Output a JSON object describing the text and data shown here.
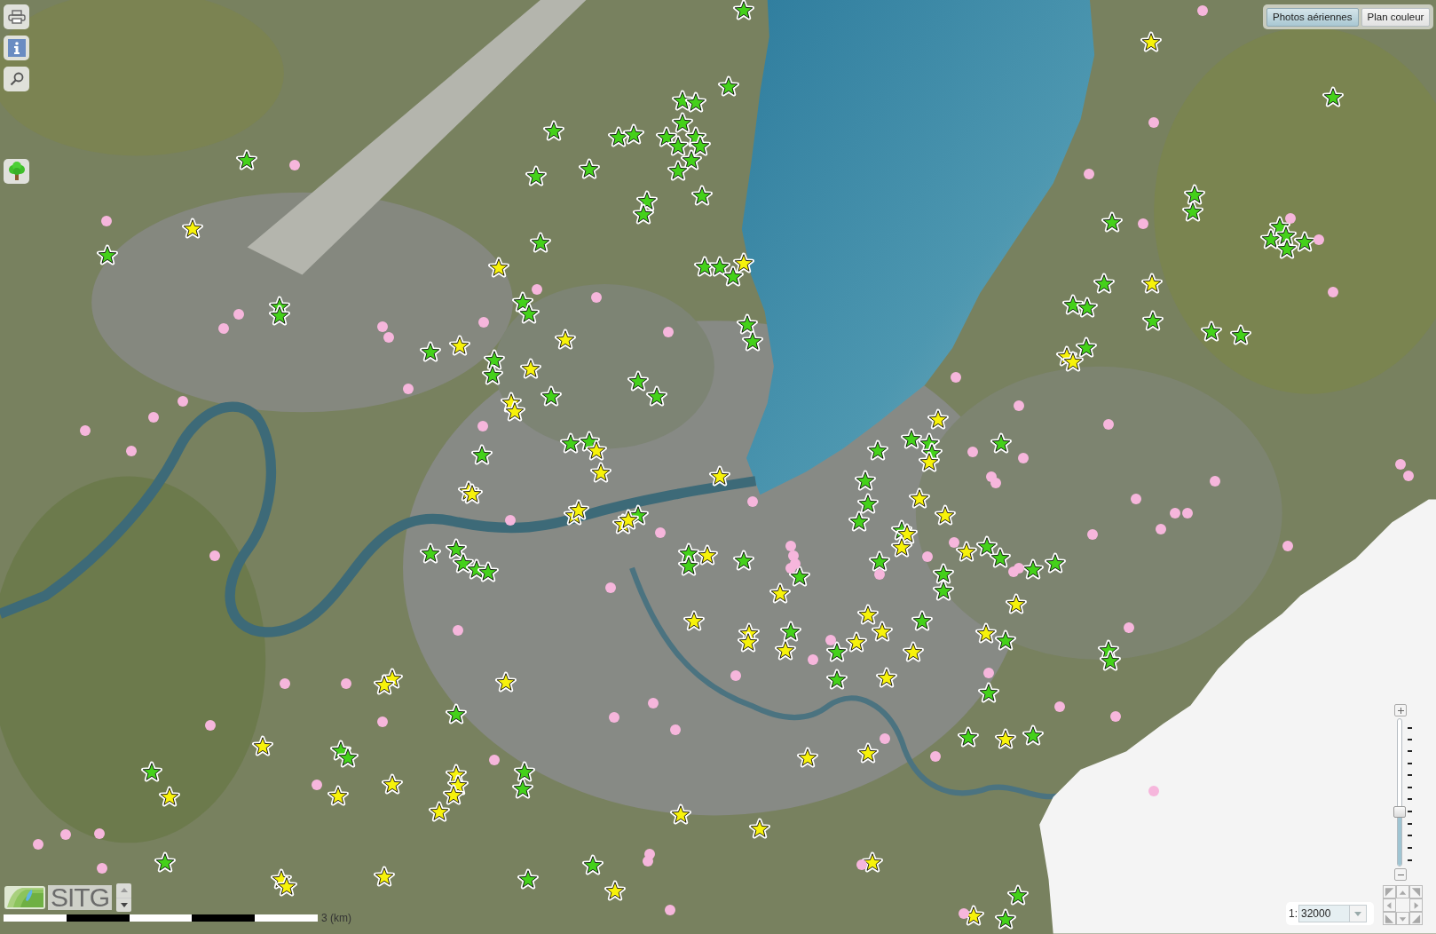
{
  "base_layers": [
    {
      "label": "Photos aériennes",
      "selected": true
    },
    {
      "label": "Plan couleur",
      "selected": false
    }
  ],
  "marker_layers": [
    {
      "kind": "star",
      "color": "#44d11a"
    },
    {
      "kind": "star",
      "color": "#f7f20a"
    },
    {
      "kind": "dot",
      "color": "#f6b6dc"
    }
  ],
  "logo": {
    "text": "SITG"
  },
  "scale_bar": {
    "label": "3 (km)"
  },
  "zoom_slider": {
    "level": 0.37
  },
  "scale_select": {
    "prefix": "1:",
    "value": "32000"
  }
}
